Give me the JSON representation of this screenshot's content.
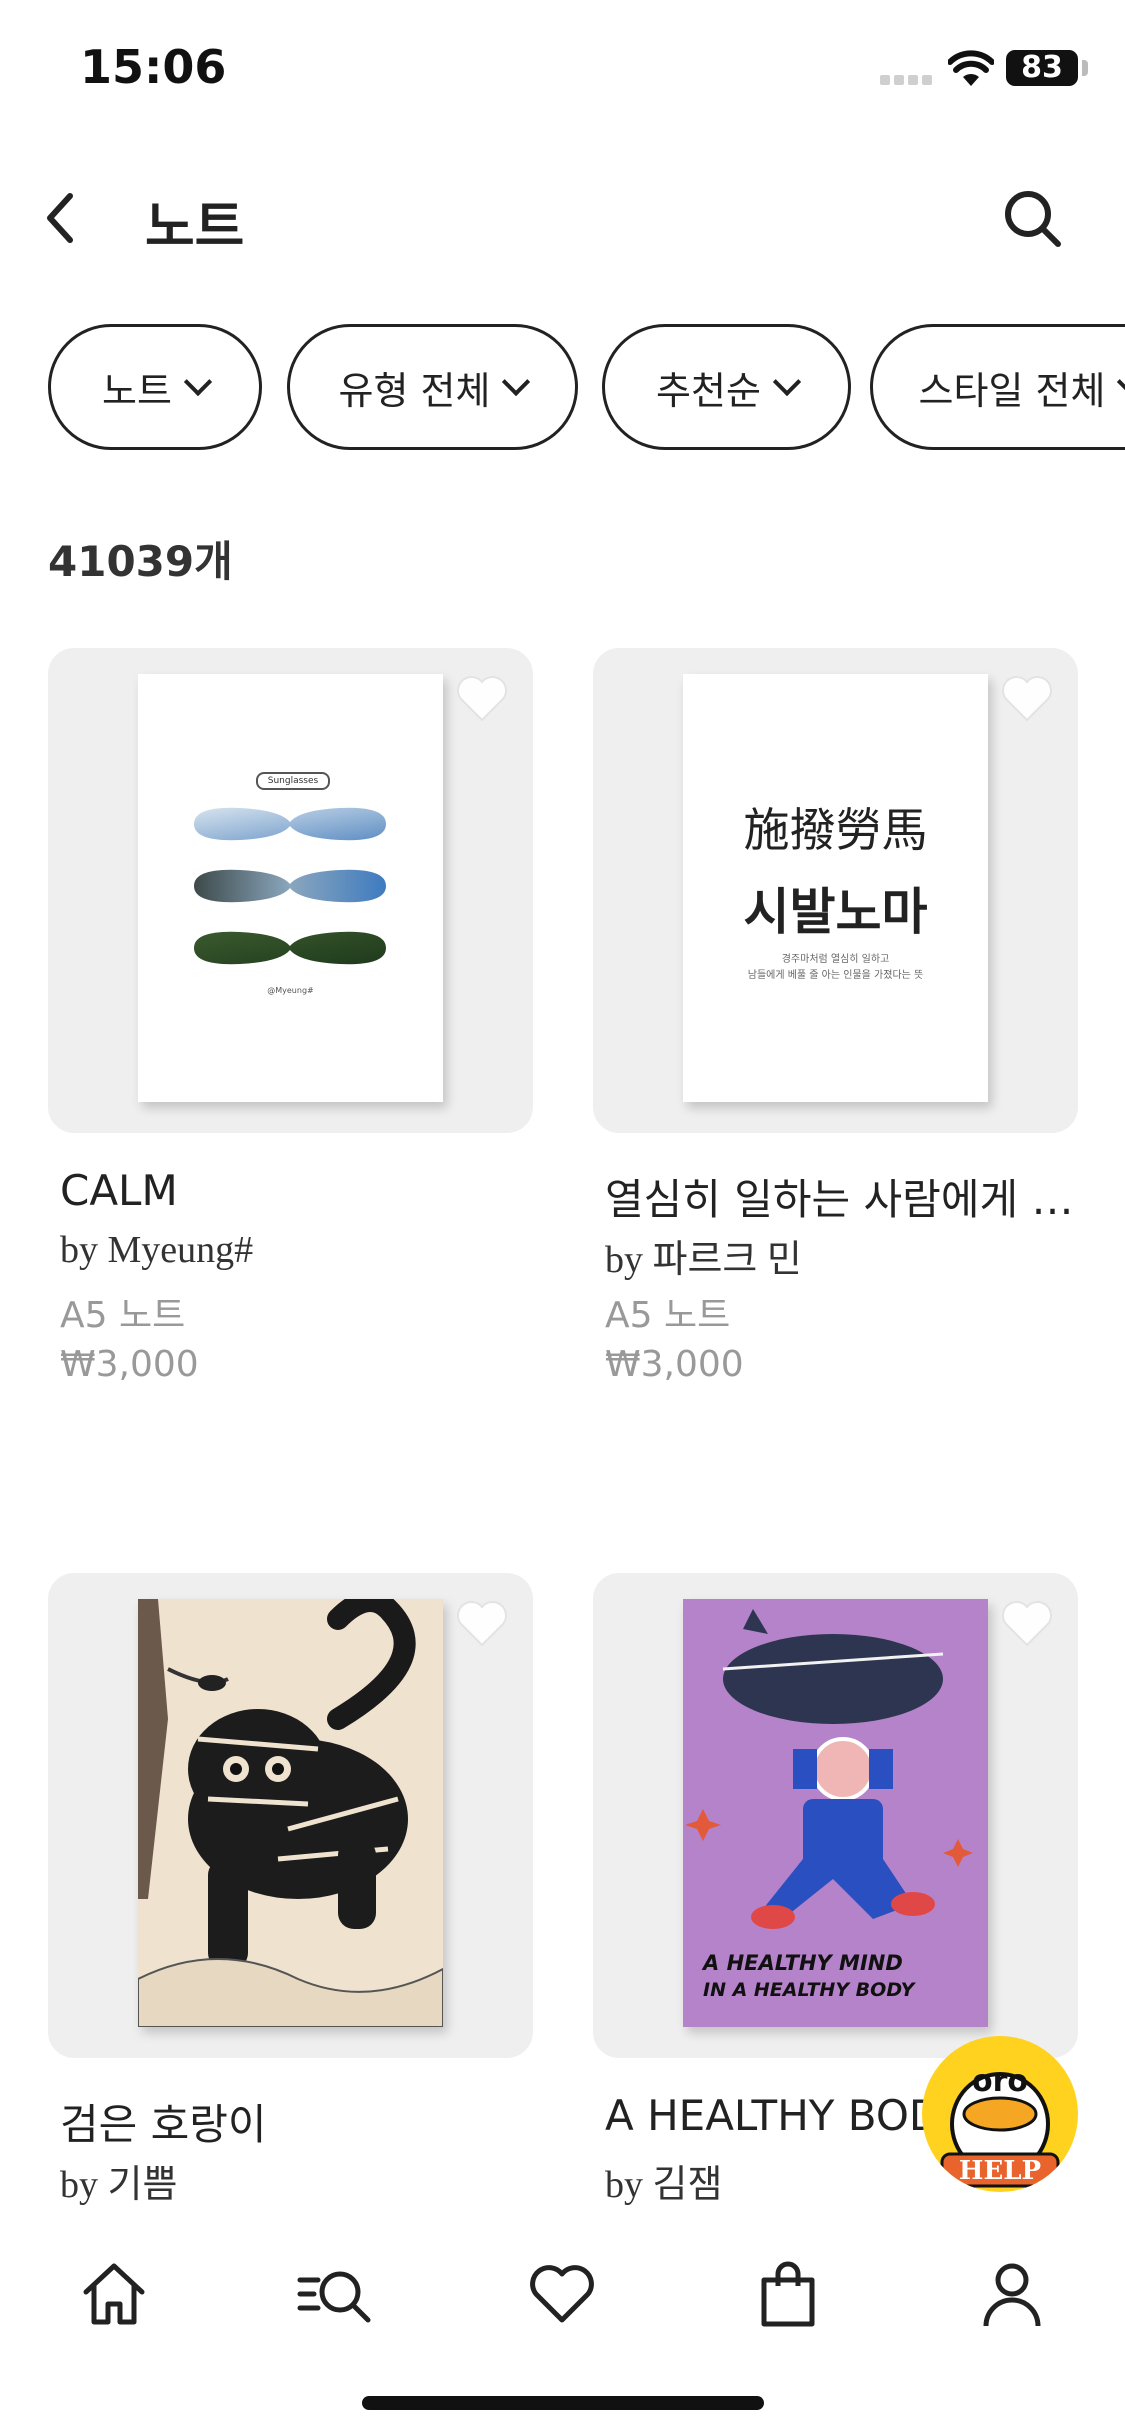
{
  "status_bar": {
    "time": "15:06",
    "battery": "83"
  },
  "header": {
    "title": "노트"
  },
  "filters": [
    {
      "label": "노트"
    },
    {
      "label": "유형 전체"
    },
    {
      "label": "추천순"
    },
    {
      "label": "스타일 전체"
    }
  ],
  "result_count": "41039개",
  "products": [
    {
      "title": "CALM",
      "author": "by Myeung#",
      "type": "A5 노트",
      "price": "₩3,000",
      "cover": {
        "badge": "Sunglasses",
        "footer": "@Myeung#"
      }
    },
    {
      "title": "열심히 일하는 사람에게 …",
      "author": "by 파르크 민",
      "type": "A5 노트",
      "price": "₩3,000",
      "cover": {
        "line1": "施撥勞馬",
        "line2": "시발노마",
        "small1": "경주마처럼 열심히 일하고",
        "small2": "남들에게 베풀 줄 아는 인물을 가졌다는 뜻"
      }
    },
    {
      "title": "검은 호랑이",
      "author": "by 기쁨"
    },
    {
      "title": "A HEALTHY BODY",
      "author": "by 김잼",
      "cover": {
        "line1": "A HEALTHY MIND",
        "line2": "IN A HEALTHY BODY"
      }
    }
  ],
  "help_button": {
    "label": "HELP",
    "face": "oro"
  },
  "bottom_nav": [
    "home-icon",
    "search-list-icon",
    "heart-icon",
    "bag-icon",
    "person-icon"
  ],
  "colors": {
    "accent": "#222222",
    "help_yellow": "#ffd21f",
    "cover_purple": "#b583c9",
    "muted": "#999999"
  }
}
